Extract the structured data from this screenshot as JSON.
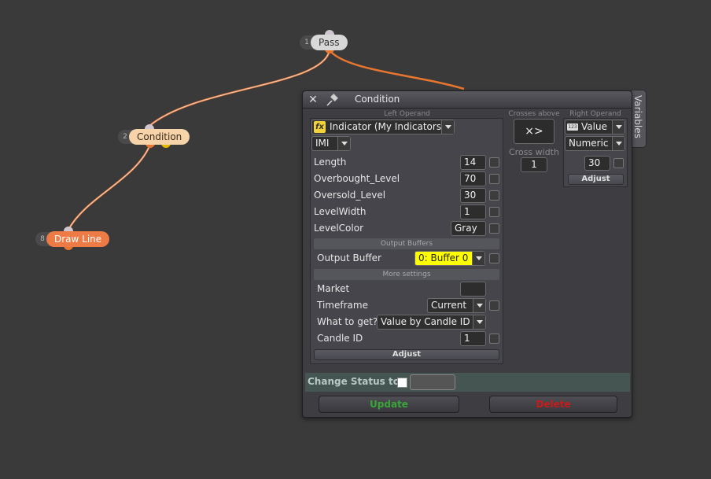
{
  "canvas": {
    "background": "#3a3a3a",
    "wire_orange": "#e8762f",
    "wire_white": "#f0e6e6"
  },
  "nodes": [
    {
      "num": "1",
      "label": "Pass"
    },
    {
      "num": "2",
      "label": "Condition"
    },
    {
      "num": "8",
      "label": "Draw Line"
    }
  ],
  "dialog": {
    "title": "Condition",
    "left_operand_caption": "Left Operand",
    "crosses_caption": "Crosses above",
    "right_operand_caption": "Right Operand",
    "indicator_icon": "function-icon",
    "indicator_select": "Indicator (My Indicators)",
    "indicator_name": "IMI",
    "params": [
      {
        "label": "Length",
        "value": "14"
      },
      {
        "label": "Overbought_Level",
        "value": "70"
      },
      {
        "label": "Oversold_Level",
        "value": "30"
      },
      {
        "label": "LevelWidth",
        "value": "1"
      },
      {
        "label": "LevelColor",
        "value": "Gray"
      }
    ],
    "output_buffers_head": "Output Buffers",
    "output_buffer_label": "Output Buffer",
    "output_buffer_value": "0: Buffer 0",
    "output_buffer_color": "#ffff00",
    "more_settings_head": "More settings",
    "market_label": "Market",
    "market_value": "",
    "timeframe_label": "Timeframe",
    "timeframe_value": "Current",
    "what_label": "What to get?",
    "what_value": "Value by Candle ID",
    "candle_label": "Candle ID",
    "candle_value": "1",
    "left_adjust": "Adjust",
    "operator_symbol": "×>",
    "cross_width_caption": "Cross width",
    "cross_width_value": "1",
    "right_type": "Value",
    "right_type_icon": "value-icon",
    "right_format": "Numeric",
    "right_value": "30",
    "right_adjust": "Adjust",
    "change_status_label": "Change Status to",
    "update_label": "Update",
    "update_color": "#3aa63a",
    "delete_label": "Delete",
    "delete_color": "#cc1a1a",
    "variables_tab": "Variables"
  }
}
